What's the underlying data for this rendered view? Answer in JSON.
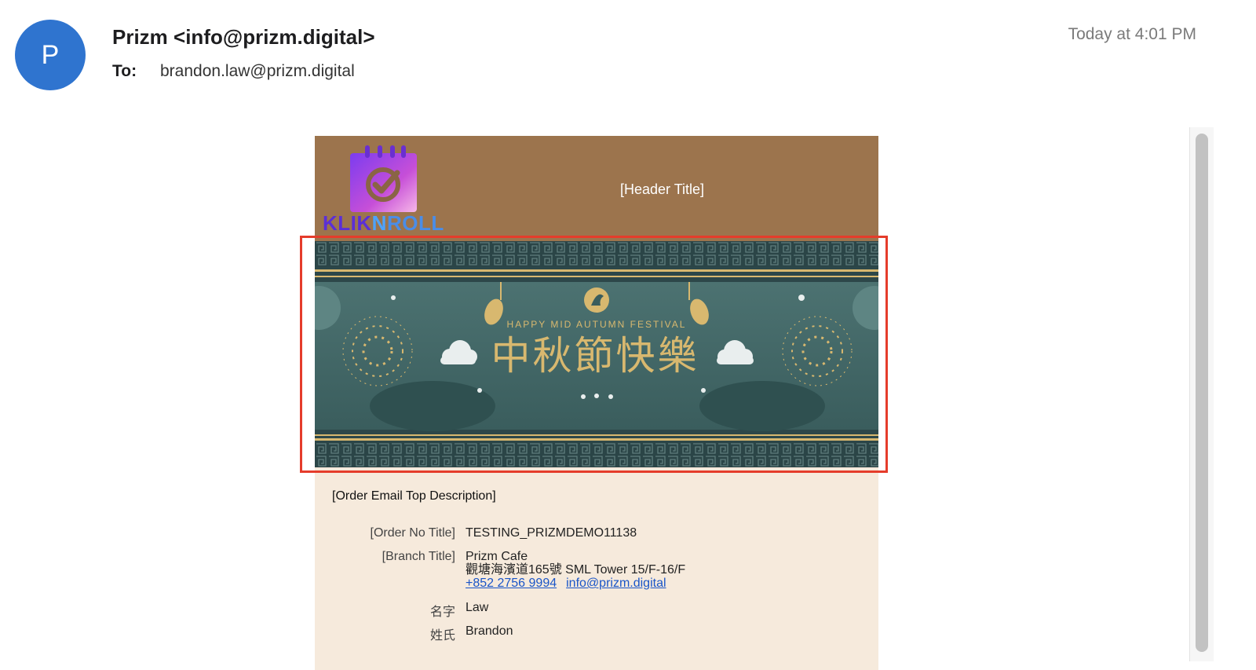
{
  "message": {
    "avatar_initial": "P",
    "sender": "Prizm <info@prizm.digital>",
    "to_label": "To:",
    "to_value": "brandon.law@prizm.digital",
    "timestamp": "Today at 4:01 PM"
  },
  "email": {
    "header_title": "[Header Title]",
    "logo_text": {
      "part1": "KLIK",
      "part2": "N",
      "part3": "ROLL"
    },
    "banner": {
      "subtitle": "HAPPY MID AUTUMN FESTIVAL",
      "title": "中秋節快樂"
    },
    "description": "[Order Email Top Description]",
    "order_no_label": "[Order No Title]",
    "order_no_value": "TESTING_PRIZMDEMO11138",
    "branch_label": "[Branch Title]",
    "branch_name": "Prizm Cafe",
    "branch_address": "觀塘海濱道165號 SML Tower 15/F-16/F",
    "branch_phone": "+852 2756 9994",
    "branch_email": "info@prizm.digital",
    "first_name_label": "名字",
    "first_name_value": "Law",
    "last_name_label": "姓氏",
    "last_name_value": "Brandon"
  },
  "colors": {
    "avatar": "#2f74cf",
    "header_bg": "#9c744d",
    "body_bg": "#f6eadc",
    "highlight": "#e53c2b",
    "banner_bg": "#2f4d4f",
    "gold": "#d8b86f"
  }
}
